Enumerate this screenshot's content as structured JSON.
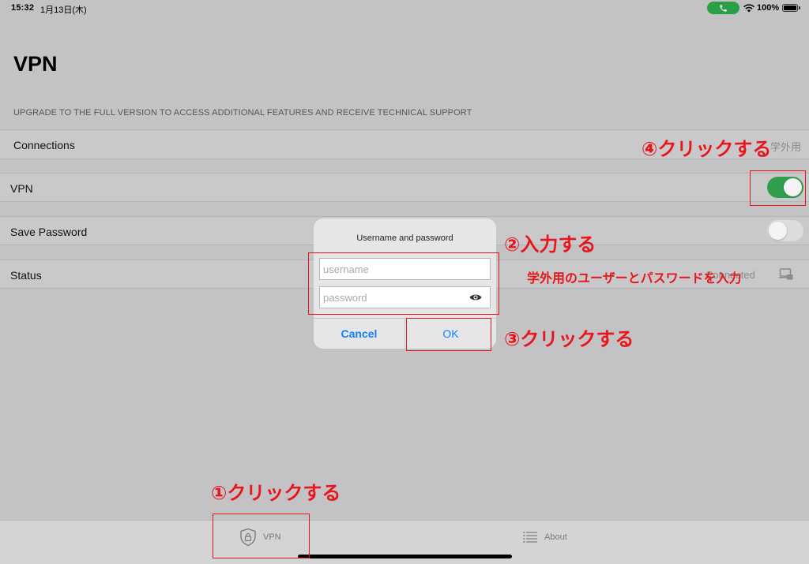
{
  "status_bar": {
    "time": "15:32",
    "date": "1月13日(木)",
    "battery": "100%"
  },
  "page": {
    "title": "VPN",
    "upgrade_note": "UPGRADE TO THE FULL VERSION TO ACCESS ADDITIONAL FEATURES AND RECEIVE TECHNICAL SUPPORT"
  },
  "rows": {
    "connections": {
      "label": "Connections",
      "value": "学外用"
    },
    "vpn": {
      "label": "VPN",
      "toggle_on": true
    },
    "save_password": {
      "label": "Save Password",
      "toggle_on": false
    },
    "status": {
      "label": "Status",
      "value": "Connected"
    }
  },
  "dialog": {
    "title": "Username and password",
    "username_placeholder": "username",
    "password_placeholder": "password",
    "cancel_label": "Cancel",
    "ok_label": "OK"
  },
  "tabbar": {
    "vpn_label": "VPN",
    "about_label": "About"
  },
  "annotations": {
    "step1": "①クリックする",
    "step2": "②入力する",
    "step2_sub": "学外用のユーザーとパスワードを入力",
    "step3": "③クリックする",
    "step4": "④クリックする"
  },
  "colors": {
    "accent": "#147efb",
    "toggle_on": "#2f9e4d",
    "annotation": "#e8151b"
  },
  "icons": {
    "call": "phone-icon",
    "wifi": "wifi-icon",
    "battery": "battery-icon",
    "eye": "eye-icon",
    "vpn_tab": "shield-lock-icon",
    "about_tab": "list-icon",
    "status": "laptop-lock-icon"
  }
}
